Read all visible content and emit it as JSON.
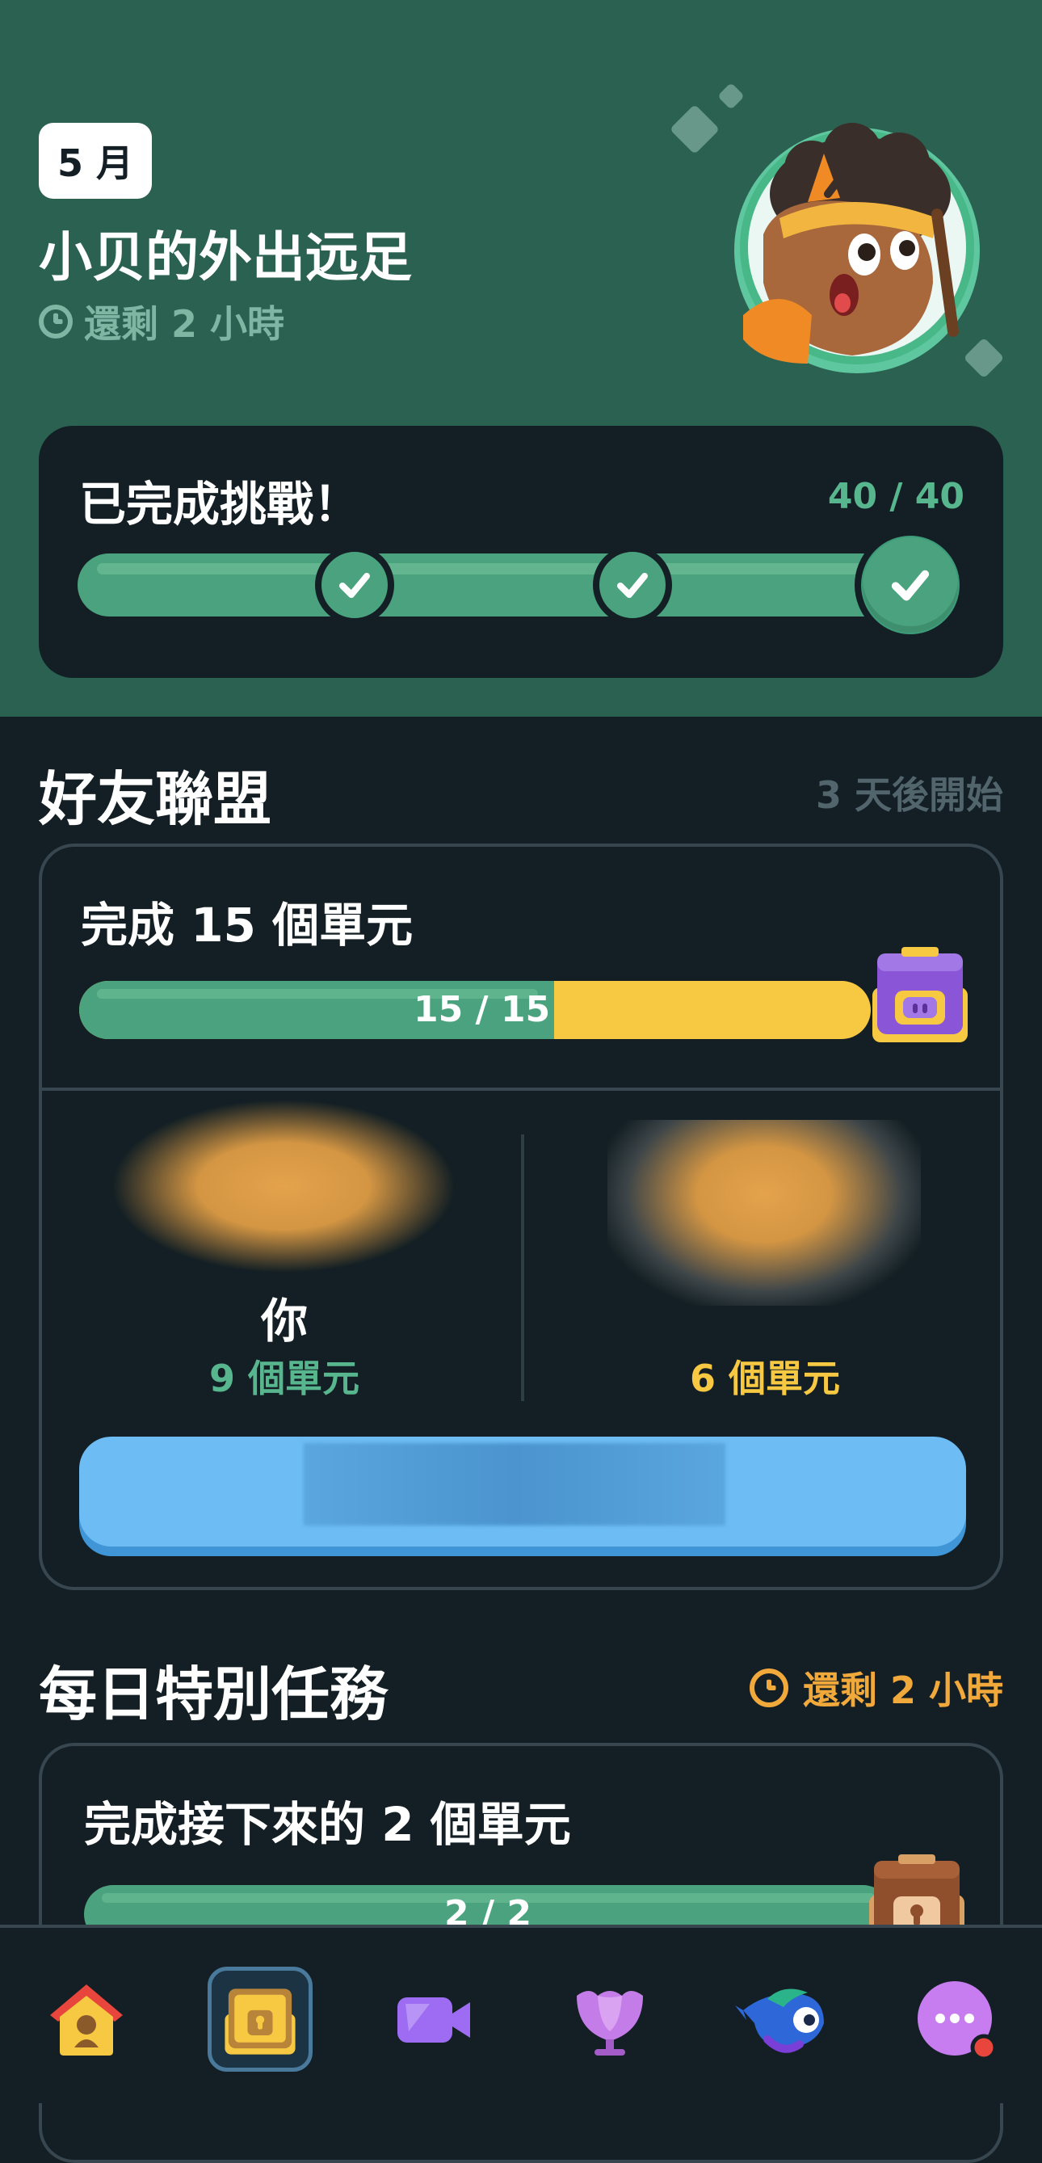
{
  "hero": {
    "month": "5 月",
    "title": "小贝的外出远足",
    "time_left": "還剩 2 小時",
    "challenge": {
      "title": "已完成挑戰！",
      "count": "40 / 40",
      "progress": 1.0
    }
  },
  "friends": {
    "section_title": "好友聯盟",
    "starts_in": "3 天後開始",
    "quest": {
      "title": "完成 15 個單元",
      "progress_label": "15 / 15",
      "my_fraction": 0.6
    },
    "me": {
      "name": "你",
      "units": "9 個單元"
    },
    "friend": {
      "units": "6 個單元"
    }
  },
  "daily": {
    "section_title": "每日特別任務",
    "time_left": "還剩 2 小時",
    "quest": {
      "title": "完成接下來的 2 個單元",
      "progress_label": "2 / 2",
      "progress": 1.0
    }
  },
  "nav": {
    "items": [
      "home-icon",
      "quests-chest-icon",
      "video-icon",
      "leagues-shield-icon",
      "character-icon",
      "more-chat-icon"
    ],
    "active": "quests-chest-icon"
  },
  "colors": {
    "hero_bg": "#2b6150",
    "page_bg": "#131f24",
    "green": "#4aa37e",
    "yellow": "#f7c942",
    "orange": "#f2a93b",
    "blue_button": "#6dbcf3",
    "purple": "#9d6cf3"
  }
}
